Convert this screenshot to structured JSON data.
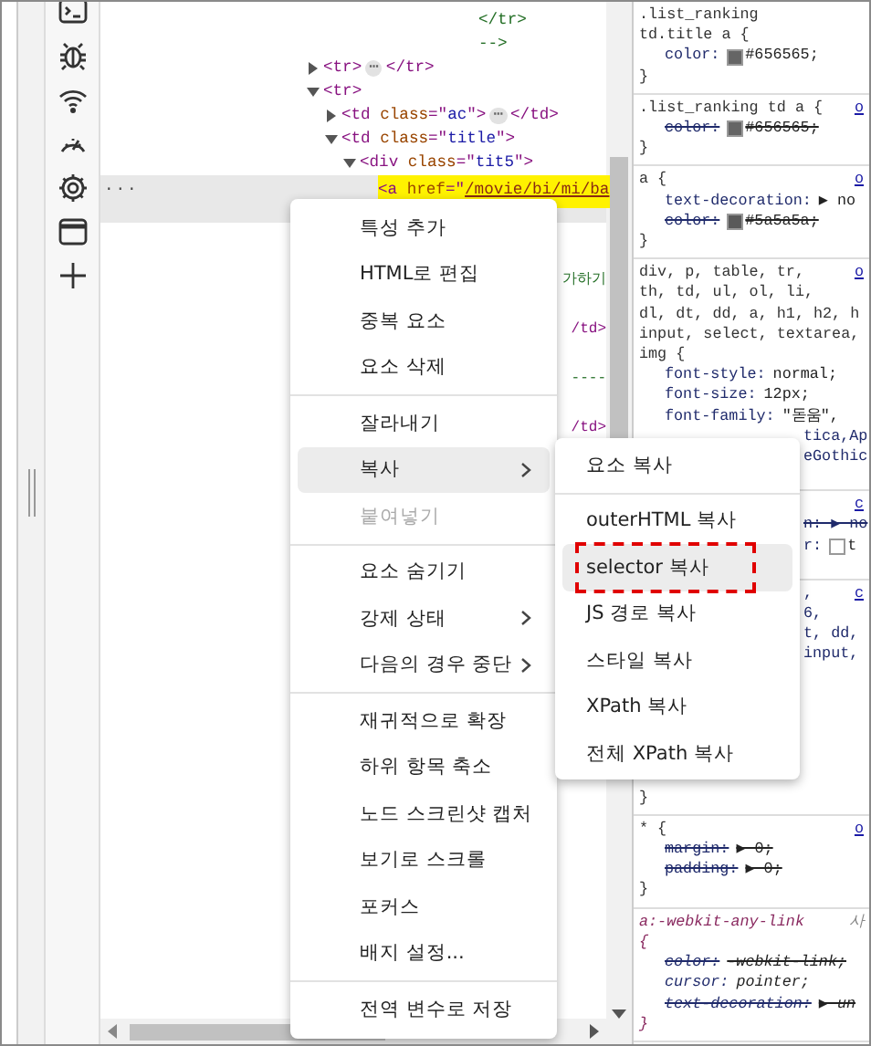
{
  "dom": {
    "comment_tail": [
      {
        "text": "</tr>"
      },
      {
        "text": "-->"
      }
    ],
    "nodes": [
      {
        "expanded": false,
        "segments": [
          {
            "kind": "tag",
            "text": "<tr>"
          },
          {
            "kind": "ellipsis",
            "text": "⋯"
          },
          {
            "kind": "tag",
            "text": "</tr>"
          }
        ]
      },
      {
        "expanded": true,
        "segments": [
          {
            "kind": "tag",
            "text": "<tr>"
          }
        ],
        "children": [
          {
            "expanded": false,
            "segments": [
              {
                "kind": "tag",
                "text": "<td"
              },
              {
                "kind": "attr",
                "text": " class"
              },
              {
                "kind": "tag",
                "text": "=\""
              },
              {
                "kind": "value",
                "text": "ac"
              },
              {
                "kind": "tag",
                "text": "\">"
              },
              {
                "kind": "ellipsis",
                "text": "⋯"
              },
              {
                "kind": "tag",
                "text": "</td>"
              }
            ]
          },
          {
            "expanded": true,
            "segments": [
              {
                "kind": "tag",
                "text": "<td"
              },
              {
                "kind": "attr",
                "text": " class"
              },
              {
                "kind": "tag",
                "text": "=\""
              },
              {
                "kind": "value",
                "text": "title"
              },
              {
                "kind": "tag",
                "text": "\">"
              }
            ],
            "children": [
              {
                "expanded": true,
                "segments": [
                  {
                    "kind": "tag",
                    "text": "<div"
                  },
                  {
                    "kind": "attr",
                    "text": " class"
                  },
                  {
                    "kind": "tag",
                    "text": "=\""
                  },
                  {
                    "kind": "value",
                    "text": "tit5"
                  },
                  {
                    "kind": "tag",
                    "text": "\">"
                  }
                ],
                "children": [
                  {
                    "selected": true,
                    "highlighted": true,
                    "marker": "...",
                    "segments": [
                      {
                        "kind": "tag",
                        "text": "<a"
                      },
                      {
                        "kind": "attr",
                        "text": " href"
                      },
                      {
                        "kind": "tag",
                        "text": "=\""
                      },
                      {
                        "kind": "link",
                        "text": "/movie/bi/mi/ba"
                      }
                    ]
                  }
                ]
              }
            ]
          }
        ]
      }
    ],
    "fragments": [
      {
        "kind": "comment",
        "text": "가하기"
      },
      {
        "kind": "tag",
        "text": "/td>"
      },
      {
        "kind": "comment",
        "text": "----"
      },
      {
        "kind": "tag",
        "text": "/td>"
      }
    ]
  },
  "context_menu": {
    "groups": [
      [
        {
          "label": "특성 추가",
          "selected": false,
          "disabled": false,
          "has_submenu": false
        },
        {
          "label": "HTML로 편집",
          "selected": false,
          "disabled": false,
          "has_submenu": false
        },
        {
          "label": "중복 요소",
          "selected": false,
          "disabled": false,
          "has_submenu": false
        },
        {
          "label": "요소 삭제",
          "selected": false,
          "disabled": false,
          "has_submenu": false
        }
      ],
      [
        {
          "label": "잘라내기",
          "selected": false,
          "disabled": false,
          "has_submenu": false
        },
        {
          "label": "복사",
          "selected": true,
          "disabled": false,
          "has_submenu": true
        },
        {
          "label": "붙여넣기",
          "selected": false,
          "disabled": true,
          "has_submenu": false
        }
      ],
      [
        {
          "label": "요소 숨기기",
          "selected": false,
          "disabled": false,
          "has_submenu": false
        },
        {
          "label": "강제 상태",
          "selected": false,
          "disabled": false,
          "has_submenu": true
        },
        {
          "label": "다음의 경우 중단",
          "selected": false,
          "disabled": false,
          "has_submenu": true
        }
      ],
      [
        {
          "label": "재귀적으로 확장",
          "selected": false,
          "disabled": false,
          "has_submenu": false
        },
        {
          "label": "하위 항목 축소",
          "selected": false,
          "disabled": false,
          "has_submenu": false
        },
        {
          "label": "노드 스크린샷 캡처",
          "selected": false,
          "disabled": false,
          "has_submenu": false
        },
        {
          "label": "보기로 스크롤",
          "selected": false,
          "disabled": false,
          "has_submenu": false
        },
        {
          "label": "포커스",
          "selected": false,
          "disabled": false,
          "has_submenu": false
        },
        {
          "label": "배지 설정...",
          "selected": false,
          "disabled": false,
          "has_submenu": false
        }
      ],
      [
        {
          "label": "전역 변수로 저장",
          "selected": false,
          "disabled": false,
          "has_submenu": false
        }
      ]
    ]
  },
  "submenu": {
    "groups": [
      [
        {
          "label": "요소 복사",
          "selected": false,
          "annotated": false
        }
      ],
      [
        {
          "label": "outerHTML 복사",
          "selected": false,
          "annotated": false
        },
        {
          "label": "selector 복사",
          "selected": true,
          "annotated": true
        },
        {
          "label": "JS 경로 복사",
          "selected": false,
          "annotated": false
        },
        {
          "label": "스타일 복사",
          "selected": false,
          "annotated": false
        },
        {
          "label": "XPath 복사",
          "selected": false,
          "annotated": false
        },
        {
          "label": "전체 XPath 복사",
          "selected": false,
          "annotated": false
        }
      ]
    ]
  },
  "styles": [
    {
      "kind": "plain",
      "lines": [
        {
          "kind": "selector",
          "text": ".list_ranking"
        },
        {
          "kind": "selector",
          "text": "td.title a {"
        },
        {
          "kind": "prop",
          "name": "color:",
          "color": "#656565",
          "value": "#656565;",
          "strike": false
        },
        {
          "kind": "close",
          "text": "}"
        }
      ]
    },
    {
      "kind": "plain",
      "lines": [
        {
          "kind": "selector",
          "text": ".list_ranking td a {",
          "source": "o"
        },
        {
          "kind": "prop",
          "name": "color:",
          "color": "#656565",
          "value": "#656565;",
          "strike": true
        },
        {
          "kind": "close",
          "text": "}"
        }
      ]
    },
    {
      "kind": "plain",
      "lines": [
        {
          "kind": "selector",
          "text": "a {",
          "source": "o"
        },
        {
          "kind": "prop",
          "name": "text-decoration:",
          "value": "▶ no",
          "strike": false
        },
        {
          "kind": "prop",
          "name": "color:",
          "color": "#5a5a5a",
          "value": "#5a5a5a;",
          "strike": true
        },
        {
          "kind": "close",
          "text": "}"
        }
      ]
    },
    {
      "kind": "covered",
      "lines": [
        {
          "kind": "selector",
          "text": "div, p, table, tr,",
          "source": "o"
        },
        {
          "kind": "selector",
          "text": "th, td, ul, ol, li,"
        },
        {
          "kind": "selector",
          "text": "dl, dt, dd, a, h1, h2, h"
        },
        {
          "kind": "selector",
          "text": "input, select, textarea,"
        },
        {
          "kind": "selector",
          "text": "img {"
        },
        {
          "kind": "prop",
          "name": "font-style:",
          "value": "normal;",
          "strike": false
        },
        {
          "kind": "prop",
          "name": "font-size:",
          "value": "12px;",
          "strike": false
        },
        {
          "kind": "prop",
          "name": "font-family:",
          "value": "\"돋움\",",
          "strike": false
        },
        {
          "kind": "tail",
          "text": "tica,Ap",
          "strike": false
        },
        {
          "kind": "tail",
          "text": "eGothic",
          "strike": false
        }
      ]
    },
    {
      "kind": "covered",
      "lines": [
        {
          "kind": "source",
          "source": "c"
        },
        {
          "kind": "tail",
          "text": "n: ▶ no",
          "strike": true
        },
        {
          "kind": "tail",
          "text": "r:",
          "color": "#ffffff",
          "value": "t",
          "strike": false
        }
      ]
    },
    {
      "kind": "gap",
      "lines": [
        {
          "kind": "tail",
          "text": ",",
          "source": "c",
          "strike": false
        },
        {
          "kind": "tail",
          "text": "6,",
          "strike": false
        },
        {
          "kind": "tail",
          "text": "t, dd,",
          "strike": false
        },
        {
          "kind": "tail",
          "text": " input,",
          "strike": false
        },
        {
          "kind": "close",
          "text": "}"
        }
      ]
    },
    {
      "kind": "plain",
      "lines": [
        {
          "kind": "selector",
          "text": "* {",
          "source": "o"
        },
        {
          "kind": "prop",
          "name": "margin:",
          "value": "▶ 0;",
          "strike": true
        },
        {
          "kind": "prop",
          "name": "padding:",
          "value": "▶ 0;",
          "strike": true
        },
        {
          "kind": "close",
          "text": "}"
        }
      ]
    },
    {
      "kind": "ua",
      "lines": [
        {
          "kind": "selector",
          "text": "a:-webkit-any-link",
          "source": "사"
        },
        {
          "kind": "selector",
          "text": "{"
        },
        {
          "kind": "prop",
          "name": "color:",
          "value": "-webkit-link;",
          "strike": true
        },
        {
          "kind": "prop",
          "name": "cursor:",
          "value": "pointer;",
          "strike": false
        },
        {
          "kind": "prop",
          "name": "text-decoration:",
          "value": "▶ un",
          "strike": true
        },
        {
          "kind": "close",
          "text": "}"
        }
      ]
    }
  ]
}
